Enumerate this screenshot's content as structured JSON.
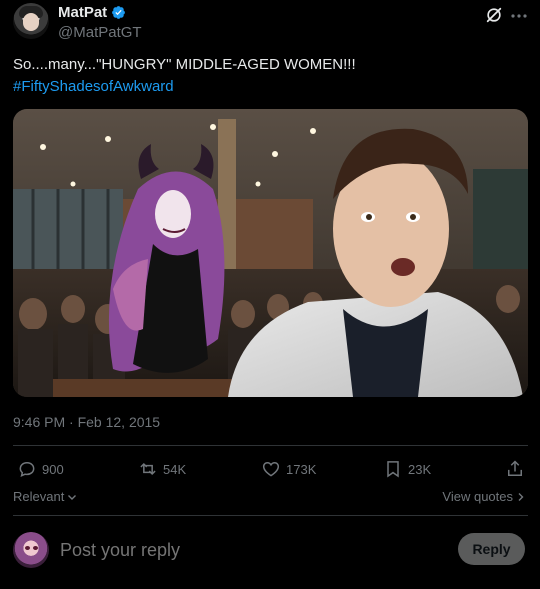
{
  "author": {
    "display_name": "MatPat",
    "handle": "@MatPatGT",
    "verified_icon": "verified-badge-icon"
  },
  "header_icons": [
    "grok-icon",
    "more-icon"
  ],
  "tweet": {
    "text": "So....many...\"HUNGRY\" MIDDLE-AGED WOMEN!!!",
    "hashtag": "#FiftyShadesofAwkward"
  },
  "timestamp": "9:46 PM · Feb 12, 2015",
  "stats": {
    "replies": "900",
    "reposts": "54K",
    "likes": "173K",
    "bookmarks": "23K"
  },
  "sort": {
    "label": "Relevant",
    "view_quotes": "View quotes"
  },
  "reply": {
    "placeholder": "Post your reply",
    "button_label": "Reply"
  },
  "colors": {
    "background": "#000000",
    "text": "#e7e9ea",
    "secondary": "#71767b",
    "link": "#1d9bf0",
    "verified": "#1d9bf0",
    "divider": "#2f3336"
  }
}
